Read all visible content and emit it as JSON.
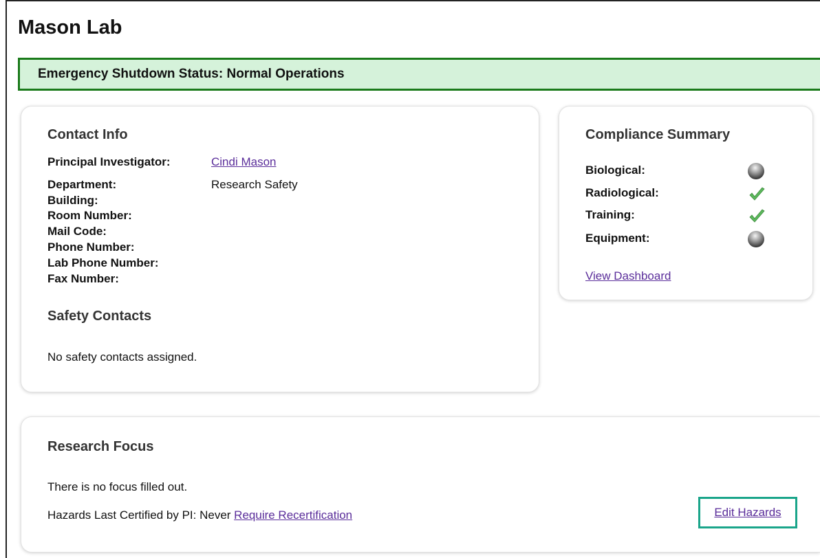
{
  "page": {
    "title": "Mason Lab"
  },
  "status_banner": {
    "text": "Emergency Shutdown Status: Normal Operations",
    "background": "#d5f2da",
    "border": "#1a7a1a"
  },
  "contact_info": {
    "heading": "Contact Info",
    "rows": [
      {
        "label": "Principal Investigator:",
        "value": "Cindi Mason",
        "is_link": true
      },
      {
        "label": "Department:",
        "value": "Research Safety"
      },
      {
        "label": "Building:",
        "value": ""
      },
      {
        "label": "Room Number:",
        "value": ""
      },
      {
        "label": "Mail Code:",
        "value": ""
      },
      {
        "label": "Phone Number:",
        "value": ""
      },
      {
        "label": "Lab Phone Number:",
        "value": ""
      },
      {
        "label": "Fax Number:",
        "value": ""
      }
    ]
  },
  "safety_contacts": {
    "heading": "Safety Contacts",
    "empty_text": "No safety contacts assigned."
  },
  "compliance_summary": {
    "heading": "Compliance Summary",
    "items": [
      {
        "label": "Biological:",
        "icon": "gray-ball-icon"
      },
      {
        "label": "Radiological:",
        "icon": "green-check-icon"
      },
      {
        "label": "Training:",
        "icon": "green-check-icon"
      },
      {
        "label": "Equipment:",
        "icon": "gray-ball-icon"
      }
    ],
    "link": "View Dashboard"
  },
  "research_focus": {
    "heading": "Research Focus",
    "empty_text": "There is no focus filled out.",
    "certified_text": "Hazards Last Certified by PI: Never",
    "recert_link": "Require Recertification",
    "edit_link": "Edit Hazards"
  },
  "colors": {
    "link": "#5a2d9a",
    "check": "#4caf50",
    "highlight_box": "#1aa58a"
  }
}
